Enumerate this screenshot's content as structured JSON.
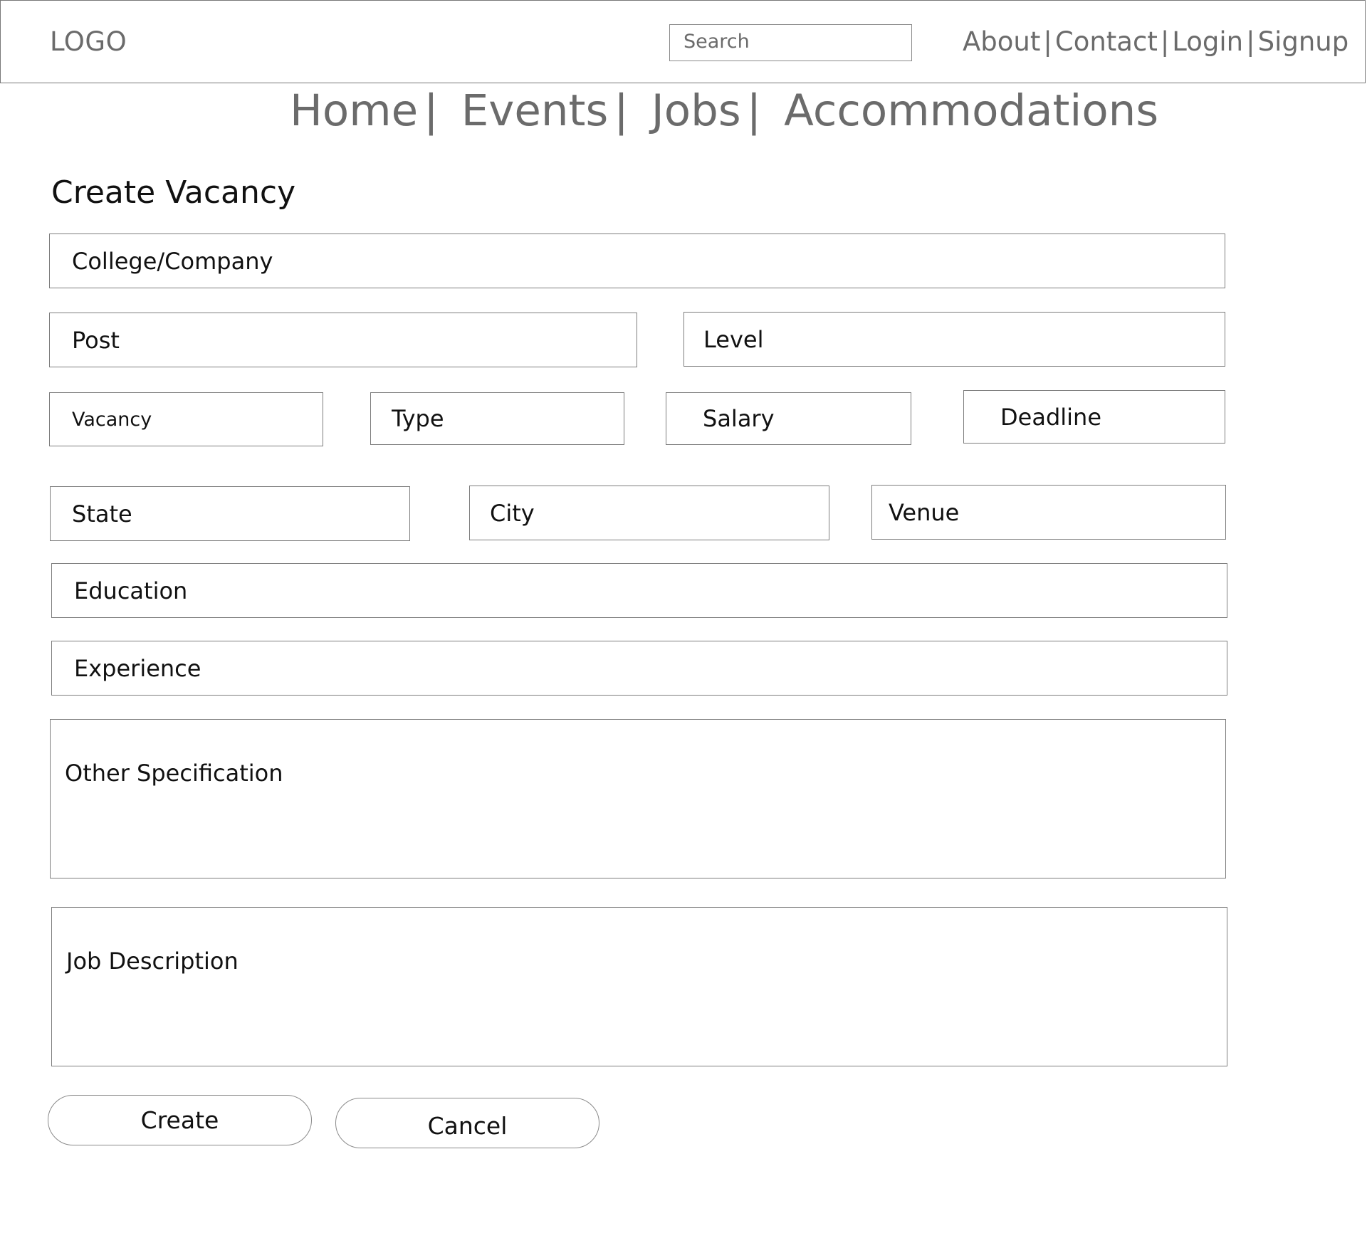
{
  "header": {
    "logo": "LOGO",
    "search_placeholder": "Search",
    "links": [
      "About",
      "Contact",
      "Login",
      "Signup"
    ],
    "separator": "|"
  },
  "main_nav": {
    "items": [
      "Home",
      "Events",
      "Jobs",
      "Accommodations"
    ],
    "separator": "|"
  },
  "page_title": "Create Vacancy",
  "form": {
    "college_company": "College/Company",
    "post": "Post",
    "level": "Level",
    "vacancy": "Vacancy",
    "type": "Type",
    "salary": "Salary",
    "deadline": "Deadline",
    "state": "State",
    "city": "City",
    "venue": "Venue",
    "education": "Education",
    "experience": "Experience",
    "other_specification": "Other Specification",
    "job_description": "Job Description"
  },
  "buttons": {
    "create": "Create",
    "cancel": "Cancel"
  }
}
